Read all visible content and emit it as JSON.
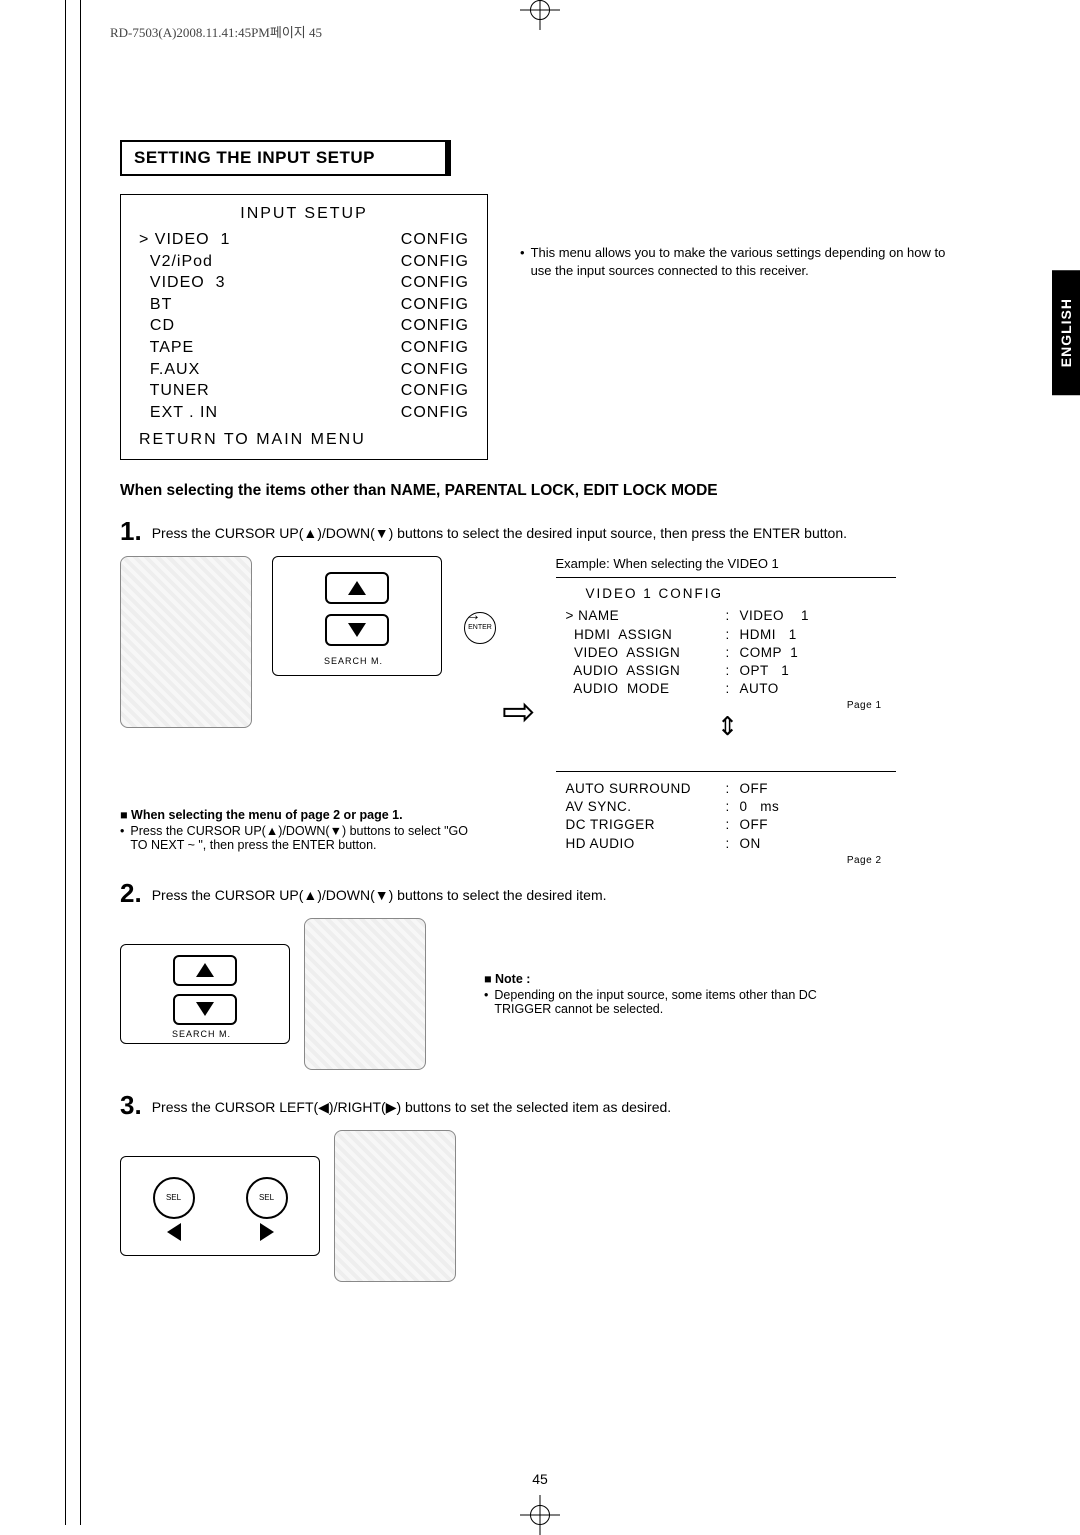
{
  "print_header": "RD-7503(A)2008.11.41:45PM페이지 45",
  "language_tab": "ENGLISH",
  "section_title": "SETTING THE INPUT SETUP",
  "osd_main": {
    "title": "INPUT  SETUP",
    "rows": [
      {
        "left": "> VIDEO  1",
        "right": "CONFIG"
      },
      {
        "left": "  V2/iPod",
        "right": "CONFIG"
      },
      {
        "left": "  VIDEO  3",
        "right": "CONFIG"
      },
      {
        "left": "  BT",
        "right": "CONFIG"
      },
      {
        "left": "  CD",
        "right": "CONFIG"
      },
      {
        "left": "  TAPE",
        "right": "CONFIG"
      },
      {
        "left": "  F.AUX",
        "right": "CONFIG"
      },
      {
        "left": "  TUNER",
        "right": "CONFIG"
      },
      {
        "left": "  EXT . IN",
        "right": "CONFIG"
      }
    ],
    "footer": "RETURN  TO  MAIN   MENU"
  },
  "intro_text": "This menu allows you to make the various settings depending on how to use the input sources connected to this receiver.",
  "heading_2": "When selecting the items other than NAME, PARENTAL LOCK, EDIT LOCK MODE",
  "steps": {
    "s1_num": "1.",
    "s1_text": "Press the CURSOR UP(▲)/DOWN(▼) buttons to select the desired input source, then press the ENTER button.",
    "s2_num": "2.",
    "s2_text": "Press the CURSOR UP(▲)/DOWN(▼) buttons to select the desired item.",
    "s3_num": "3.",
    "s3_text": "Press the CURSOR LEFT(◀)/RIGHT(▶) buttons to set the selected item as desired."
  },
  "inset_labels": {
    "enter": "ENTER",
    "search_m": "SEARCH M.",
    "sel": "SEL"
  },
  "subnote": {
    "title": "■ When selecting the menu of page 2 or page 1.",
    "bullet": "Press the CURSOR UP(▲)/DOWN(▼) buttons to select \"GO TO NEXT ~ \", then press the ENTER button."
  },
  "example": {
    "title": "Example: When selecting the VIDEO 1",
    "box1": {
      "header": "VIDEO  1      CONFIG",
      "rows": [
        {
          "c1": "> NAME",
          "c3": "VIDEO    1"
        },
        {
          "c1": "  HDMI  ASSIGN",
          "c3": "HDMI   1"
        },
        {
          "c1": "  VIDEO  ASSIGN",
          "c3": "COMP  1"
        },
        {
          "c1": "  AUDIO  ASSIGN",
          "c3": "OPT   1"
        },
        {
          "c1": "  AUDIO  MODE",
          "c3": "AUTO"
        }
      ],
      "page_tag": "Page 1"
    },
    "box2": {
      "rows": [
        {
          "c1": "AUTO SURROUND",
          "c3": "OFF"
        },
        {
          "c1": "AV SYNC.",
          "c3": "0   ms"
        },
        {
          "c1": "DC TRIGGER",
          "c3": "OFF"
        },
        {
          "c1": "HD AUDIO",
          "c3": "ON"
        }
      ],
      "page_tag": "Page 2"
    }
  },
  "note": {
    "title": "■ Note :",
    "bullet": "Depending on the input source, some items other than DC TRIGGER cannot be selected."
  },
  "page_number": "45"
}
